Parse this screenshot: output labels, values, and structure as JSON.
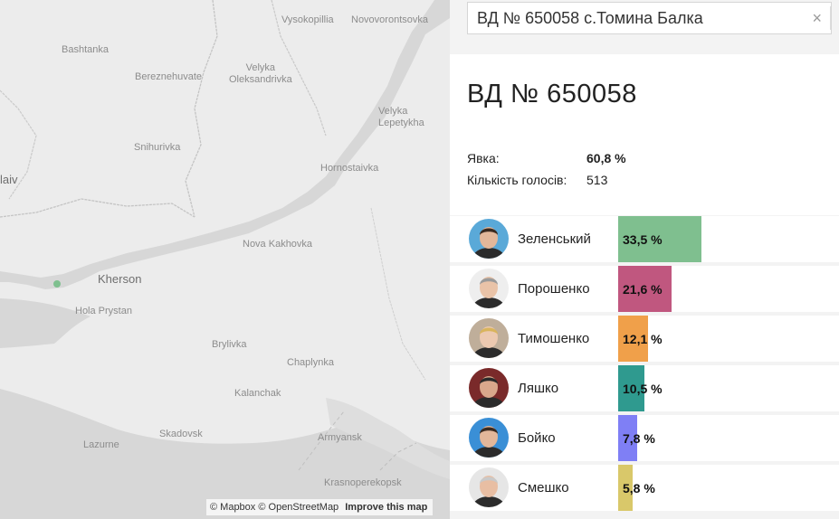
{
  "map": {
    "places": [
      {
        "id": "vysokopillia",
        "label": "Vysokopillia"
      },
      {
        "id": "novovorontsovka",
        "label": "Novovorontsovka"
      },
      {
        "id": "bashtanka",
        "label": "Bashtanka"
      },
      {
        "id": "bereznehuvate",
        "label": "Bereznehuvate"
      },
      {
        "id": "velyka-oleksandrivka",
        "label": "Velyka\nOleksandrivka"
      },
      {
        "id": "velyka-lepetykha",
        "label": "Velyka\nLepetykha"
      },
      {
        "id": "snihurivka",
        "label": "Snihurivka"
      },
      {
        "id": "hornostaivka",
        "label": "Hornostaivka"
      },
      {
        "id": "mykolaiv",
        "label": "laiv"
      },
      {
        "id": "nova-kakhovka",
        "label": "Nova Kakhovka"
      },
      {
        "id": "kherson",
        "label": "Kherson"
      },
      {
        "id": "hola-prystan",
        "label": "Hola Prystan"
      },
      {
        "id": "brylivka",
        "label": "Brylivka"
      },
      {
        "id": "chaplynka",
        "label": "Chaplynka"
      },
      {
        "id": "kalanchak",
        "label": "Kalanchak"
      },
      {
        "id": "skadovsk",
        "label": "Skadovsk"
      },
      {
        "id": "lazurne",
        "label": "Lazurne"
      },
      {
        "id": "armyansk",
        "label": "Armyansk"
      },
      {
        "id": "krasnoperekopsk",
        "label": "Krasnoperekopsk"
      }
    ],
    "attribution": {
      "mapbox": "© Mapbox",
      "osm": "© OpenStreetMap",
      "improve": "Improve this map"
    },
    "marker_color": "#7fc08f"
  },
  "search": {
    "value": "ВД № 650058 с.Томина Балка",
    "clear_label": "×"
  },
  "station": {
    "title": "ВД № 650058",
    "turnout_label": "Явка:",
    "turnout_value": "60,8 %",
    "votes_label": "Кількість голосів:",
    "votes_value": "513"
  },
  "candidates": [
    {
      "name": "Зеленський",
      "percent_label": "33,5 %",
      "percent": 33.5,
      "color": "#7fbf8f"
    },
    {
      "name": "Порошенко",
      "percent_label": "21,6 %",
      "percent": 21.6,
      "color": "#c0577f"
    },
    {
      "name": "Тимошенко",
      "percent_label": "12,1 %",
      "percent": 12.1,
      "color": "#f0a04a"
    },
    {
      "name": "Ляшко",
      "percent_label": "10,5 %",
      "percent": 10.5,
      "color": "#2f9a8f"
    },
    {
      "name": "Бойко",
      "percent_label": "7,8 %",
      "percent": 7.8,
      "color": "#7f7ff5"
    },
    {
      "name": "Смешко",
      "percent_label": "5,8 %",
      "percent": 5.8,
      "color": "#d9c86a"
    }
  ]
}
